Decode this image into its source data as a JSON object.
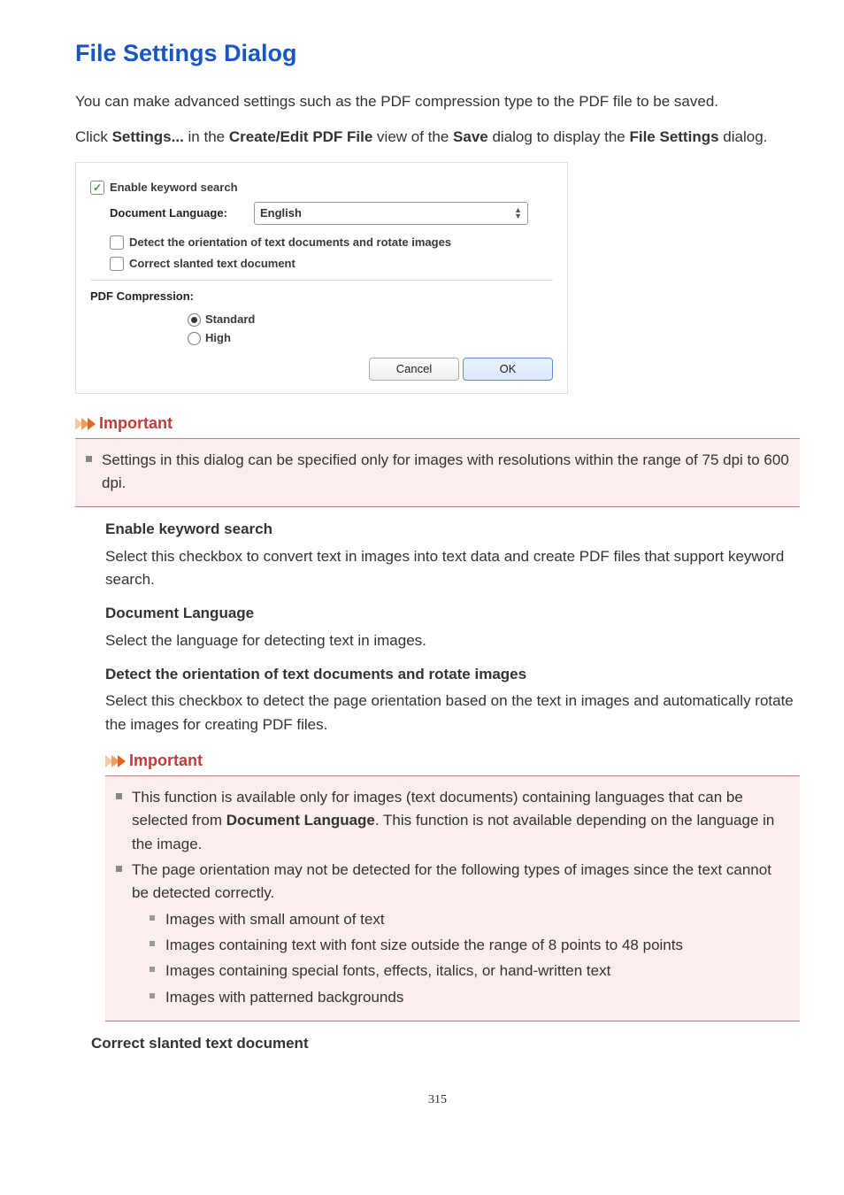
{
  "title": "File Settings Dialog",
  "intro1": "You can make advanced settings such as the PDF compression type to the PDF file to be saved.",
  "intro2_pre": "Click ",
  "intro2_b1": "Settings...",
  "intro2_mid1": " in the ",
  "intro2_b2": "Create/Edit PDF File",
  "intro2_mid2": " view of the ",
  "intro2_b3": "Save",
  "intro2_mid3": " dialog to display the ",
  "intro2_b4": "File Settings",
  "intro2_post": " dialog.",
  "dialog": {
    "enable_keyword": "Enable keyword search",
    "doc_lang_label": "Document Language:",
    "doc_lang_value": "English",
    "detect_orient": "Detect the orientation of text documents and rotate images",
    "correct_slant": "Correct slanted text document",
    "pdf_comp": "PDF Compression:",
    "standard": "Standard",
    "high": "High",
    "cancel": "Cancel",
    "ok": "OK"
  },
  "important_label": "Important",
  "imp1_text": "Settings in this dialog can be specified only for images with resolutions within the range of 75 dpi to 600 dpi.",
  "terms": {
    "t1": "Enable keyword search",
    "d1": "Select this checkbox to convert text in images into text data and create PDF files that support keyword search.",
    "t2": "Document Language",
    "d2": "Select the language for detecting text in images.",
    "t3": "Detect the orientation of text documents and rotate images",
    "d3": "Select this checkbox to detect the page orientation based on the text in images and automatically rotate the images for creating PDF files.",
    "t4": "Correct slanted text document"
  },
  "imp2": {
    "li1_pre": "This function is available only for images (text documents) containing languages that can be selected from ",
    "li1_b": "Document Language",
    "li1_post": ". This function is not available depending on the language in the image.",
    "li2": "The page orientation may not be detected for the following types of images since the text cannot be detected correctly.",
    "sub1": "Images with small amount of text",
    "sub2": "Images containing text with font size outside the range of 8 points to 48 points",
    "sub3": "Images containing special fonts, effects, italics, or hand-written text",
    "sub4": "Images with patterned backgrounds"
  },
  "page_number": "315"
}
